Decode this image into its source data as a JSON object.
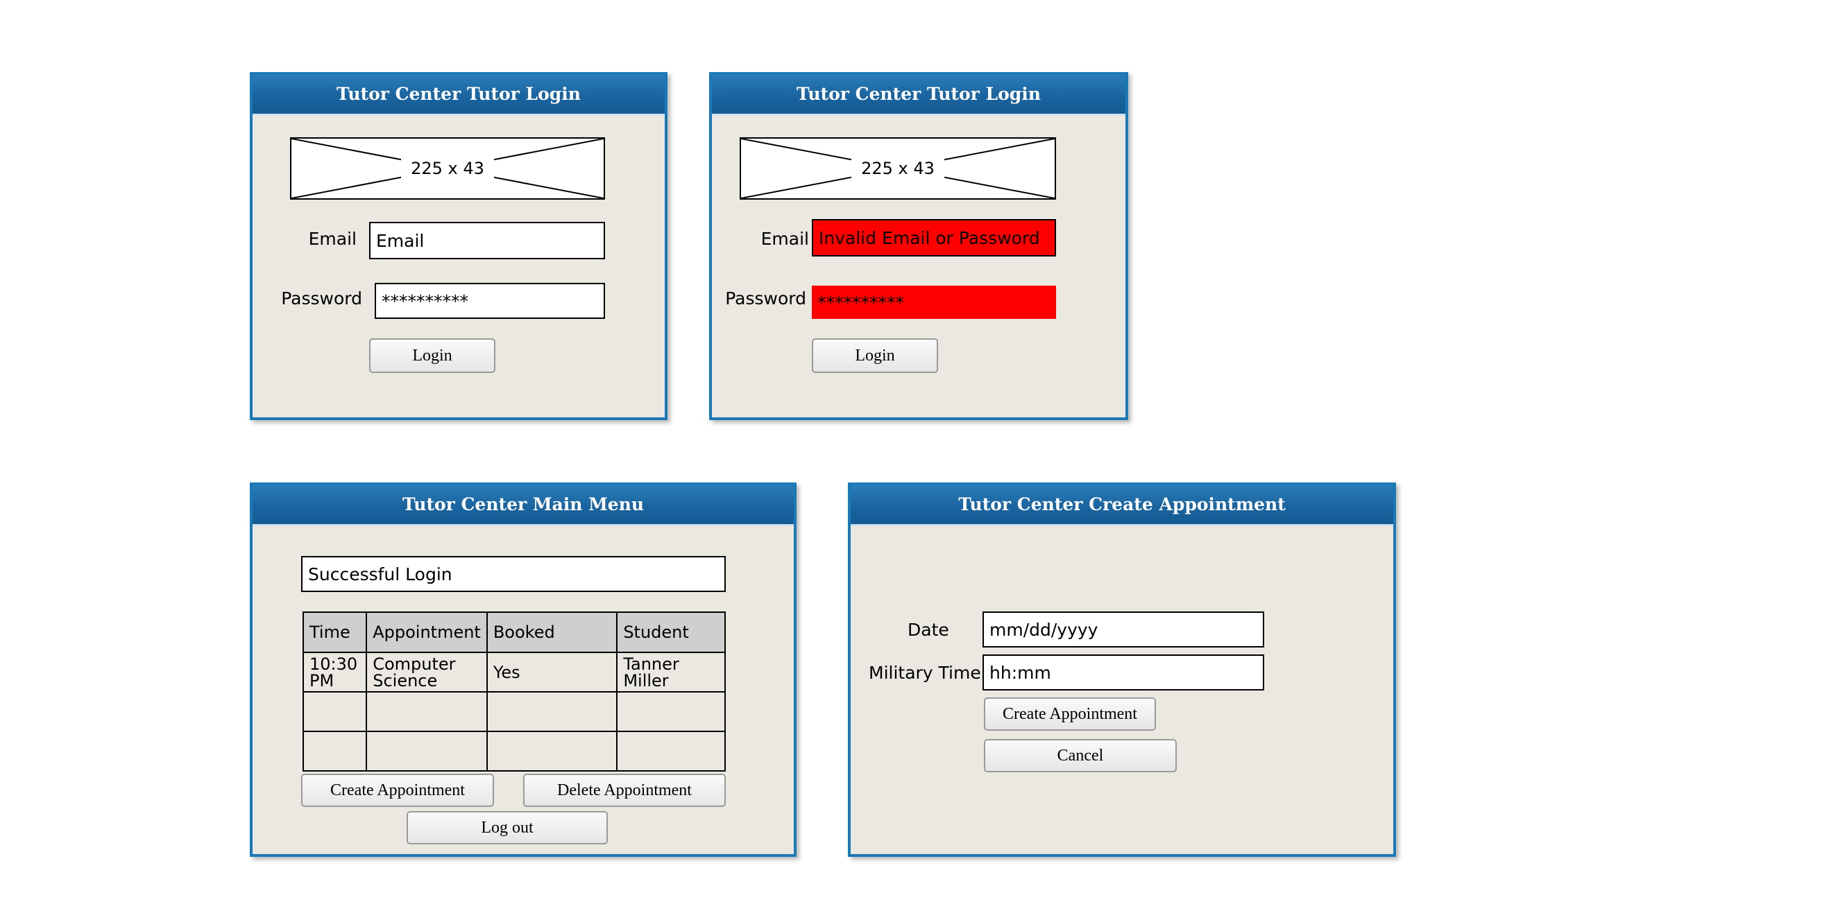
{
  "login_normal": {
    "title": "Tutor Center Tutor Login",
    "image_caption": "225 x 43",
    "email_label": "Email",
    "email_value": "Email",
    "password_label": "Password",
    "password_value": "**********",
    "login_button": "Login"
  },
  "login_error": {
    "title": "Tutor Center Tutor Login",
    "image_caption": "225 x 43",
    "email_label": "Email",
    "email_value": "Invalid Email or Password",
    "password_label": "Password",
    "password_value": "**********",
    "login_button": "Login",
    "error_color": "#ff0000"
  },
  "main_menu": {
    "title": "Tutor Center Main Menu",
    "status_message": "Successful Login",
    "table": {
      "headers": [
        "Time",
        "Appointment",
        "Booked",
        "Student"
      ],
      "rows": [
        [
          "10:30 PM",
          "Computer Science",
          "Yes",
          "Tanner Miller"
        ],
        [
          "",
          "",
          "",
          ""
        ],
        [
          "",
          "",
          "",
          ""
        ]
      ]
    },
    "create_button": "Create Appointment",
    "delete_button": "Delete Appointment",
    "logout_button": "Log out"
  },
  "create_appointment": {
    "title": "Tutor Center Create Appointment",
    "date_label": "Date",
    "date_value": "mm/dd/yyyy",
    "time_label": "Military Time",
    "time_value": "hh:mm",
    "create_button": "Create Appointment",
    "cancel_button": "Cancel"
  },
  "colors": {
    "title_bar": "#1a64a0",
    "window_border": "#1c79b7",
    "window_bg": "#ebe8e2"
  }
}
